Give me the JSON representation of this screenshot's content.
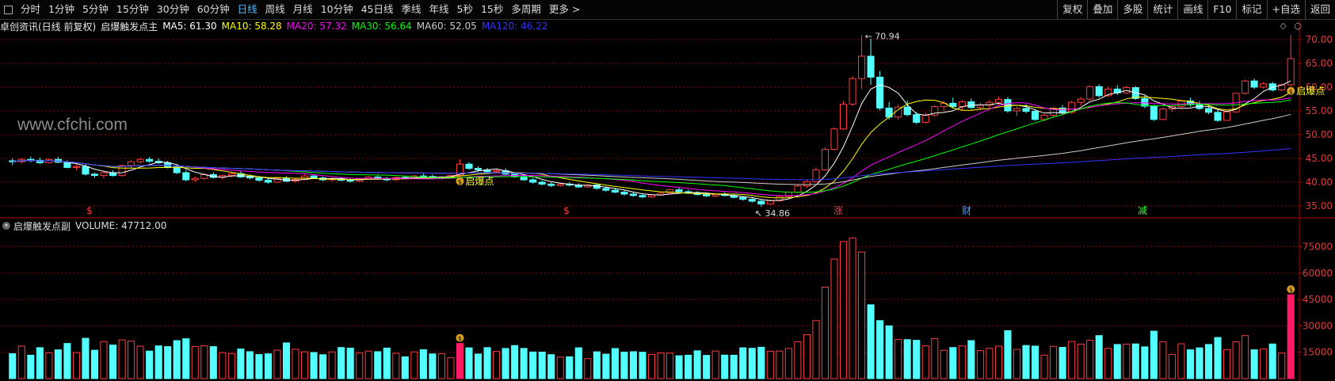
{
  "toolbar": {
    "periods": [
      "分时",
      "1分钟",
      "5分钟",
      "15分钟",
      "30分钟",
      "60分钟",
      "日线",
      "周线",
      "月线",
      "10分钟",
      "45日线",
      "季线",
      "年线",
      "5秒",
      "15秒",
      "多周期",
      "更多 >"
    ],
    "active": "日线",
    "right_items": [
      "复权",
      "叠加",
      "多股",
      "统计",
      "画线",
      "F10",
      "标记",
      "+自选",
      "返回"
    ]
  },
  "main_header": {
    "stock": "卓创资讯(日线 前复权)",
    "indicator": "启爆触发点主",
    "ma": [
      {
        "label": "MA5: 61.30",
        "color": "#ffffff"
      },
      {
        "label": "MA10: 58.28",
        "color": "#ffff00"
      },
      {
        "label": "MA20: 57.32",
        "color": "#ff00ff"
      },
      {
        "label": "MA30: 56.64",
        "color": "#00ff00"
      },
      {
        "label": "MA60: 52.05",
        "color": "#cccccc"
      },
      {
        "label": "MA120: 46.22",
        "color": "#3333ff"
      }
    ]
  },
  "sub_header": {
    "indicator": "启爆触发点副",
    "volume": "VOLUME: 47712.00"
  },
  "watermark": "www.cfchi.com",
  "annotations": {
    "high": "70.94",
    "low": "34.86",
    "signal": "启爆点",
    "events": [
      "$",
      "$",
      "涨",
      "财",
      "减"
    ]
  },
  "colors": {
    "up": "#ff3c3c",
    "down": "#54ffff",
    "grid": "#8b0000",
    "axis_text": "#e23a3a",
    "signal_bar": "#ff1a66"
  },
  "chart_data": [
    {
      "type": "candlestick",
      "title": "",
      "y_ticks": [
        70,
        65,
        60,
        55,
        50,
        45,
        40,
        35
      ],
      "ylim": [
        33,
        72
      ],
      "series_names": [
        "MA5",
        "MA10",
        "MA20",
        "MA30",
        "MA60",
        "MA120"
      ],
      "price_high": 70.94,
      "price_low": 34.86,
      "ohlc": [
        [
          44.5,
          45,
          43.6,
          44.3
        ],
        [
          44.3,
          45.1,
          43.9,
          44.8
        ],
        [
          44.8,
          45.4,
          44.2,
          44.6
        ],
        [
          44.6,
          45.2,
          43.8,
          44.1
        ],
        [
          44.1,
          45,
          43.9,
          44.8
        ],
        [
          44.8,
          45.3,
          44,
          44.2
        ],
        [
          44.2,
          44.6,
          42.9,
          43.1
        ],
        [
          43.1,
          43.8,
          42.5,
          43.3
        ],
        [
          43.3,
          43.8,
          41.4,
          41.7
        ],
        [
          41.7,
          42,
          40.9,
          41.4
        ],
        [
          41.4,
          42.3,
          40.8,
          42
        ],
        [
          42,
          42.5,
          41.2,
          41.4
        ],
        [
          41.4,
          43.7,
          41.2,
          43.5
        ],
        [
          43.5,
          44.6,
          43,
          44.3
        ],
        [
          44.3,
          45.2,
          43.9,
          44.8
        ],
        [
          44.8,
          45.3,
          44.1,
          44.4
        ],
        [
          44.4,
          45,
          43.8,
          44.1
        ],
        [
          44.1,
          44.5,
          42.9,
          43.2
        ],
        [
          43.2,
          43.6,
          41.7,
          42
        ],
        [
          42,
          42.5,
          40.2,
          40.5
        ],
        [
          40.5,
          41.2,
          40,
          40.8
        ],
        [
          40.8,
          42,
          40.5,
          41.6
        ],
        [
          41.6,
          42.1,
          40.8,
          41
        ],
        [
          41,
          41.6,
          40.6,
          41.4
        ],
        [
          41.4,
          42.2,
          41,
          41.8
        ],
        [
          41.8,
          42.3,
          40.9,
          41.1
        ],
        [
          41.1,
          41.6,
          40.6,
          40.9
        ],
        [
          40.9,
          41.3,
          40.1,
          40.4
        ],
        [
          40.4,
          40.8,
          39.7,
          40
        ],
        [
          40,
          41,
          39.8,
          40.8
        ],
        [
          40.8,
          41.3,
          40,
          40.2
        ],
        [
          40.2,
          40.9,
          39.9,
          40.6
        ],
        [
          40.6,
          41.6,
          40.4,
          41.3
        ],
        [
          41.3,
          41.7,
          40.7,
          40.9
        ],
        [
          40.9,
          41.2,
          40.2,
          40.5
        ],
        [
          40.5,
          41,
          40.1,
          40.7
        ],
        [
          40.7,
          41.1,
          40.2,
          40.4
        ],
        [
          40.4,
          40.8,
          39.9,
          40.2
        ],
        [
          40.2,
          40.9,
          40,
          40.7
        ],
        [
          40.7,
          41.3,
          40.5,
          41.1
        ],
        [
          41.1,
          41.5,
          40.6,
          40.8
        ],
        [
          40.8,
          41.1,
          40.2,
          40.5
        ],
        [
          40.5,
          41.2,
          40.3,
          41
        ],
        [
          41,
          41.4,
          40.6,
          40.9
        ],
        [
          40.9,
          41.5,
          40.7,
          41.3
        ],
        [
          41.3,
          41.8,
          40.9,
          41.2
        ],
        [
          41.2,
          41.6,
          40.6,
          40.8
        ],
        [
          40.8,
          41.3,
          40.5,
          41.1
        ],
        [
          41.1,
          41.6,
          40.8,
          41.4
        ],
        [
          41.4,
          44.8,
          41.2,
          43.8
        ],
        [
          43.8,
          44.2,
          42.6,
          42.9
        ],
        [
          42.9,
          43.4,
          42.2,
          42.6
        ],
        [
          42.6,
          43,
          41.9,
          42.2
        ],
        [
          42.2,
          42.8,
          41.8,
          42.4
        ],
        [
          42.4,
          42.9,
          41.5,
          41.7
        ],
        [
          41.7,
          42.1,
          40.9,
          41.2
        ],
        [
          41.2,
          41.6,
          40.3,
          40.5
        ],
        [
          40.5,
          40.9,
          39.7,
          40
        ],
        [
          40,
          40.4,
          39.3,
          39.6
        ],
        [
          39.6,
          40,
          39,
          39.3
        ],
        [
          39.3,
          39.8,
          39,
          39.6
        ],
        [
          39.6,
          40,
          39.1,
          39.4
        ],
        [
          39.4,
          39.8,
          38.8,
          39
        ],
        [
          39,
          39.6,
          38.8,
          39.4
        ],
        [
          39.4,
          39.7,
          38.4,
          38.7
        ],
        [
          38.7,
          39.1,
          38,
          38.3
        ],
        [
          38.3,
          38.8,
          37.7,
          37.9
        ],
        [
          37.9,
          38.3,
          37.2,
          37.5
        ],
        [
          37.5,
          37.9,
          36.9,
          37.2
        ],
        [
          37.2,
          37.6,
          36.6,
          36.9
        ],
        [
          36.9,
          37.5,
          36.7,
          37.3
        ],
        [
          37.3,
          37.9,
          37.1,
          37.7
        ],
        [
          37.7,
          38.6,
          37.5,
          38.4
        ],
        [
          38.4,
          38.8,
          37.8,
          38
        ],
        [
          38,
          38.4,
          37.5,
          37.7
        ],
        [
          37.7,
          38.1,
          37.2,
          37.4
        ],
        [
          37.4,
          37.8,
          36.9,
          37.1
        ],
        [
          37.1,
          37.6,
          36.8,
          37.4
        ],
        [
          37.4,
          37.9,
          37,
          37.2
        ],
        [
          37.2,
          37.6,
          36.6,
          36.8
        ],
        [
          36.8,
          37.1,
          36.1,
          36.4
        ],
        [
          36.4,
          36.9,
          35.7,
          36
        ],
        [
          36,
          36.4,
          34.86,
          35.4
        ],
        [
          35.4,
          36.3,
          35.2,
          36.1
        ],
        [
          36.1,
          37.2,
          35.9,
          37
        ],
        [
          37,
          38.1,
          36.8,
          37.9
        ],
        [
          37.9,
          39.4,
          37.7,
          39.2
        ],
        [
          39.2,
          40.4,
          38.8,
          40.1
        ],
        [
          40.1,
          43.1,
          39.9,
          42.6
        ],
        [
          42.6,
          47.3,
          42.4,
          46.9
        ],
        [
          46.9,
          51.5,
          46.7,
          51.2
        ],
        [
          51.2,
          57.1,
          51,
          56.4
        ],
        [
          56.4,
          62.3,
          56,
          61.8
        ],
        [
          61.8,
          70.94,
          59.6,
          66.5
        ],
        [
          66.5,
          70.2,
          60.5,
          62.1
        ],
        [
          62.1,
          63.4,
          55.1,
          55.6
        ],
        [
          55.6,
          56.9,
          53.2,
          53.7
        ],
        [
          53.7,
          56.4,
          53.1,
          55.8
        ],
        [
          55.8,
          57.2,
          53.9,
          54.2
        ],
        [
          54.2,
          54.8,
          52.2,
          52.6
        ],
        [
          52.6,
          54.6,
          52.3,
          54.1
        ],
        [
          54.1,
          56.2,
          53.8,
          55.9
        ],
        [
          55.9,
          57.1,
          55,
          56.6
        ],
        [
          56.6,
          57.8,
          55.5,
          55.9
        ],
        [
          55.9,
          57.3,
          55.2,
          56.9
        ],
        [
          56.9,
          57.6,
          55.4,
          55.7
        ],
        [
          55.7,
          56.8,
          55.1,
          56.2
        ],
        [
          56.2,
          57.3,
          55.6,
          56.8
        ],
        [
          56.8,
          58,
          56.2,
          57.4
        ],
        [
          57.4,
          57.9,
          54.6,
          55
        ],
        [
          55,
          55.9,
          53.9,
          55.5
        ],
        [
          55.5,
          56.4,
          54.5,
          54.9
        ],
        [
          54.9,
          55.4,
          52.9,
          53.2
        ],
        [
          53.2,
          54.3,
          52.8,
          54.1
        ],
        [
          54.1,
          55.8,
          53.8,
          55.6
        ],
        [
          55.6,
          56.2,
          54.3,
          54.7
        ],
        [
          54.7,
          57.1,
          54.4,
          56.8
        ],
        [
          56.8,
          57.9,
          56.1,
          57.5
        ],
        [
          57.5,
          60.3,
          57.2,
          60.1
        ],
        [
          60.1,
          60.6,
          57.8,
          58.2
        ],
        [
          58.2,
          60.1,
          57.9,
          59.6
        ],
        [
          59.6,
          60.4,
          58.4,
          58.8
        ],
        [
          58.8,
          60.3,
          58.5,
          59.9
        ],
        [
          59.9,
          60.2,
          57.3,
          57.6
        ],
        [
          57.6,
          58.2,
          55.6,
          56
        ],
        [
          56,
          56.3,
          52.9,
          53.2
        ],
        [
          53.2,
          55.8,
          53,
          55.4
        ],
        [
          55.4,
          56.2,
          54.8,
          55.9
        ],
        [
          55.9,
          57.4,
          55.6,
          57.1
        ],
        [
          57.1,
          57.8,
          55.9,
          56.3
        ],
        [
          56.3,
          57.1,
          55.2,
          55.5
        ],
        [
          55.5,
          56.1,
          54.3,
          54.7
        ],
        [
          54.7,
          55.3,
          52.7,
          53
        ],
        [
          53,
          55.1,
          52.9,
          54.8
        ],
        [
          54.8,
          57.2,
          54.6,
          58.7
        ],
        [
          58.7,
          61.6,
          58.4,
          61.3
        ],
        [
          61.3,
          61.8,
          59.6,
          60
        ],
        [
          60,
          61.1,
          59.7,
          60.7
        ],
        [
          60.7,
          61.1,
          59.1,
          59.4
        ],
        [
          59.4,
          60.8,
          59.1,
          60.5
        ],
        [
          60.5,
          70.94,
          60.2,
          66
        ]
      ],
      "annotations_text": [
        "70.94",
        "34.86",
        "启爆点",
        "启爆点"
      ]
    },
    {
      "type": "bar",
      "title": "",
      "y_ticks": [
        75000,
        60000,
        45000,
        30000,
        15000
      ],
      "ylim": [
        0,
        82000
      ],
      "series_names": [
        "VOLUME"
      ],
      "last_value": 47712
    }
  ]
}
